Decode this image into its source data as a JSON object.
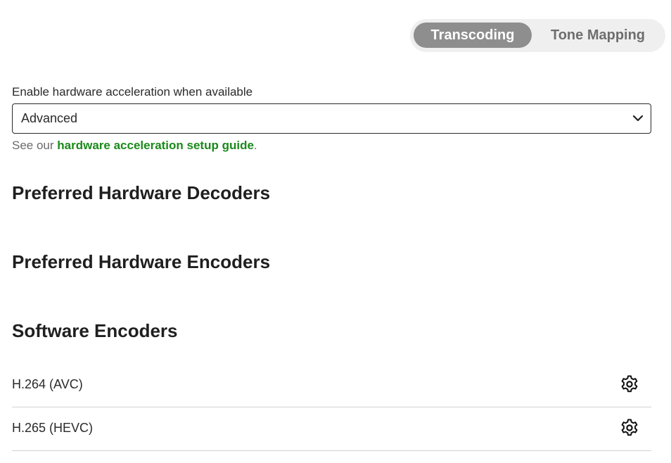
{
  "tabs": [
    {
      "label": "Transcoding",
      "active": true
    },
    {
      "label": "Tone Mapping",
      "active": false
    }
  ],
  "hw_accel": {
    "label": "Enable hardware acceleration when available",
    "value": "Advanced",
    "help_prefix": "See our ",
    "help_link": "hardware acceleration setup guide",
    "help_suffix": "."
  },
  "sections": {
    "decoders_title": "Preferred Hardware Decoders",
    "encoders_title": "Preferred Hardware Encoders",
    "software_title": "Software Encoders"
  },
  "software_encoders": [
    {
      "label": "H.264 (AVC)",
      "icon": "gear-icon"
    },
    {
      "label": "H.265 (HEVC)",
      "icon": "gear-icon"
    }
  ],
  "colors": {
    "active_tab_bg": "#8e8e8e",
    "link": "#1a8a1a"
  }
}
